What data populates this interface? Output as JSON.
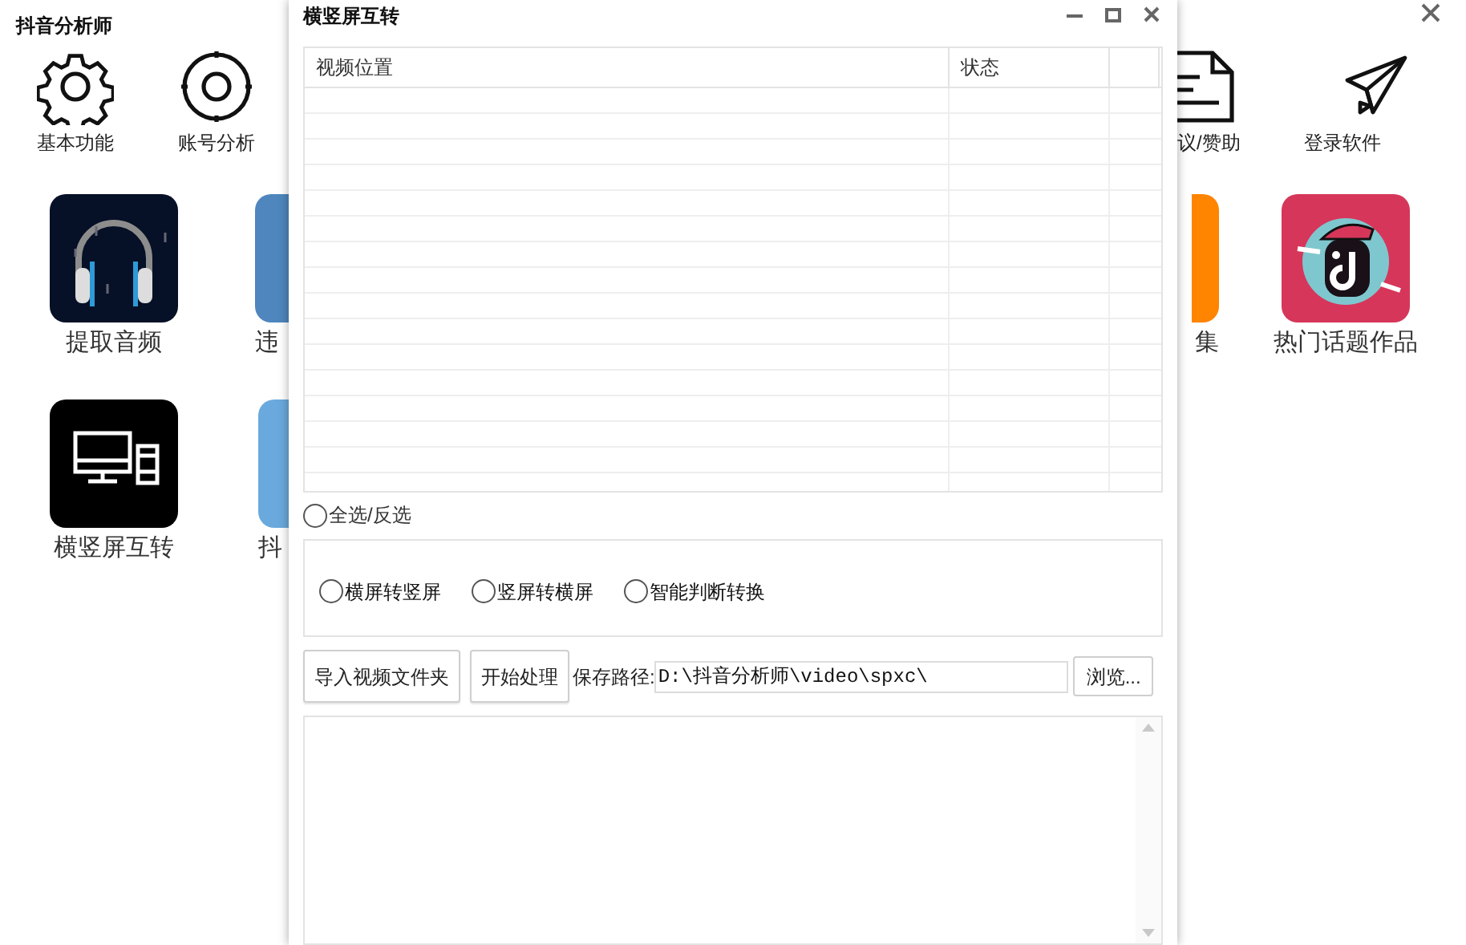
{
  "app": {
    "title": "抖音分析师"
  },
  "toolbar": [
    {
      "label": "基本功能"
    },
    {
      "label": "账号分析"
    },
    {
      "label": "议/赞助"
    },
    {
      "label": "登录软件"
    }
  ],
  "tiles": [
    {
      "label": "提取音频"
    },
    {
      "label": "违"
    },
    {
      "label": "集"
    },
    {
      "label": "热门话题作品"
    },
    {
      "label": "横竖屏互转"
    },
    {
      "label": "抖"
    }
  ],
  "dialog": {
    "title": "横竖屏互转",
    "table": {
      "columns": [
        "视频位置",
        "状态"
      ]
    },
    "select_all": {
      "label": "全选/反选",
      "checked": false
    },
    "modes": [
      {
        "label": "横屏转竖屏",
        "selected": false
      },
      {
        "label": "竖屏转横屏",
        "selected": false
      },
      {
        "label": "智能判断转换",
        "selected": false
      }
    ],
    "buttons": [
      "导入视频文件夹",
      "开始处理"
    ],
    "save_path": {
      "label": "保存路径:",
      "value": "D:\\抖音分析师\\video\\spxc\\"
    },
    "browse_button": "浏览..."
  }
}
